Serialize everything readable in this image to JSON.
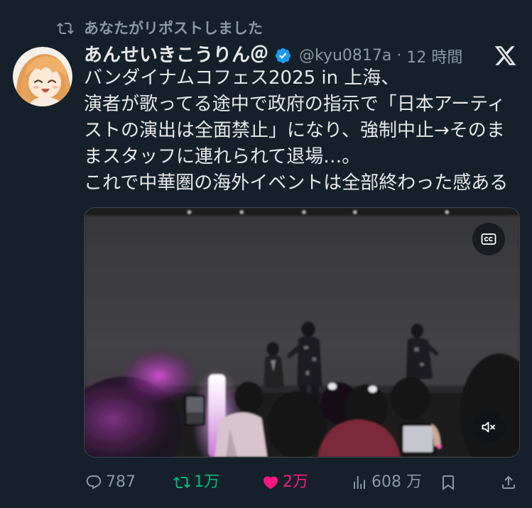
{
  "colors": {
    "background": "#15202b",
    "text": "#e7e9ea",
    "secondary_text": "#8b98a5",
    "verified": "#1d9bf0",
    "repost_active": "#00ba7c",
    "like_active": "#f91880",
    "border": "#38444d"
  },
  "repost_banner": {
    "icon": "repost-icon",
    "text": "あなたがリポストしました"
  },
  "author": {
    "name": "あんせいきこうりん＠",
    "badge_icon": "verified-badge-icon",
    "handle": "@kyu0817a",
    "separator": "·",
    "time": "12 時間"
  },
  "platform_icon": "x-logo-icon",
  "post": {
    "lines": [
      "バンダイナムコフェス2025 in 上海、",
      "演者が歌ってる途中で政府の指示で「日本アーティ",
      "ストの演出は全面禁止」になり、強制中止→そのま",
      "まスタッフに連れられて退場…。",
      "これで中華圏の海外イベントは全部終わった感ある"
    ]
  },
  "media": {
    "captions_button_icon": "closed-captions-icon",
    "sound_button_icon": "muted-speaker-icon"
  },
  "actions": {
    "reply": {
      "icon": "reply-icon",
      "count": "787"
    },
    "repost": {
      "icon": "repost-icon",
      "count": "1万"
    },
    "like": {
      "icon": "heart-filled-icon",
      "count": "2万"
    },
    "views": {
      "icon": "views-icon",
      "count": "608 万"
    },
    "bookmark": {
      "icon": "bookmark-icon"
    },
    "share": {
      "icon": "share-icon"
    }
  }
}
